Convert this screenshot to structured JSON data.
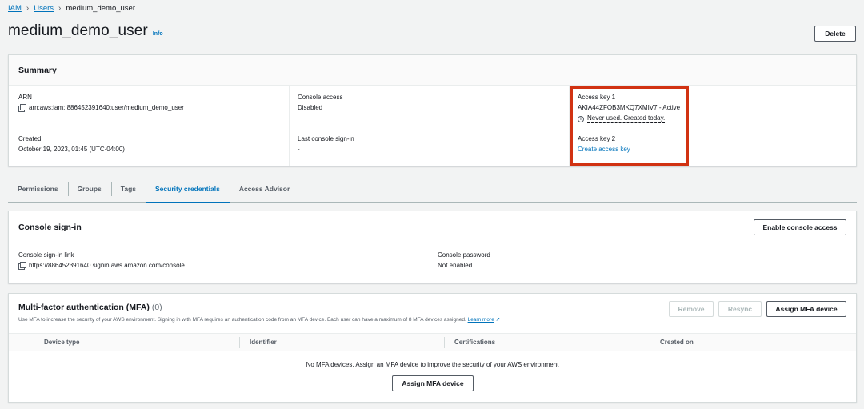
{
  "breadcrumb": {
    "root": "IAM",
    "middle": "Users",
    "current": "medium_demo_user"
  },
  "header": {
    "title": "medium_demo_user",
    "info": "Info",
    "delete_label": "Delete"
  },
  "summary": {
    "title": "Summary",
    "arn_label": "ARN",
    "arn_value": "arn:aws:iam::886452391640:user/medium_demo_user",
    "created_label": "Created",
    "created_value": "October 19, 2023, 01:45 (UTC-04:00)",
    "console_access_label": "Console access",
    "console_access_value": "Disabled",
    "last_signin_label": "Last console sign-in",
    "last_signin_value": "-",
    "key1_label": "Access key 1",
    "key1_value": "AKIA44ZFOB3MKQ7XMIV7 - Active",
    "key1_note": "Never used. Created today.",
    "key2_label": "Access key 2",
    "key2_link": "Create access key"
  },
  "tabs": [
    {
      "label": "Permissions"
    },
    {
      "label": "Groups"
    },
    {
      "label": "Tags"
    },
    {
      "label": "Security credentials"
    },
    {
      "label": "Access Advisor"
    }
  ],
  "console_signin": {
    "title": "Console sign-in",
    "enable_label": "Enable console access",
    "link_label": "Console sign-in link",
    "link_value": "https://886452391640.signin.aws.amazon.com/console",
    "password_label": "Console password",
    "password_value": "Not enabled"
  },
  "mfa": {
    "title": "Multi-factor authentication (MFA)",
    "count": "(0)",
    "description": "Use MFA to increase the security of your AWS environment. Signing in with MFA requires an authentication code from an MFA device. Each user can have a maximum of 8 MFA devices assigned.",
    "learn_more": "Learn more",
    "remove_label": "Remove",
    "resync_label": "Resync",
    "assign_label": "Assign MFA device",
    "columns": [
      "Device type",
      "Identifier",
      "Certifications",
      "Created on"
    ],
    "empty_message": "No MFA devices. Assign an MFA device to improve the security of your AWS environment",
    "assign_center_label": "Assign MFA device"
  },
  "colors": {
    "link": "#0073bb",
    "highlight": "#d13212",
    "border": "#d5dbdb"
  }
}
